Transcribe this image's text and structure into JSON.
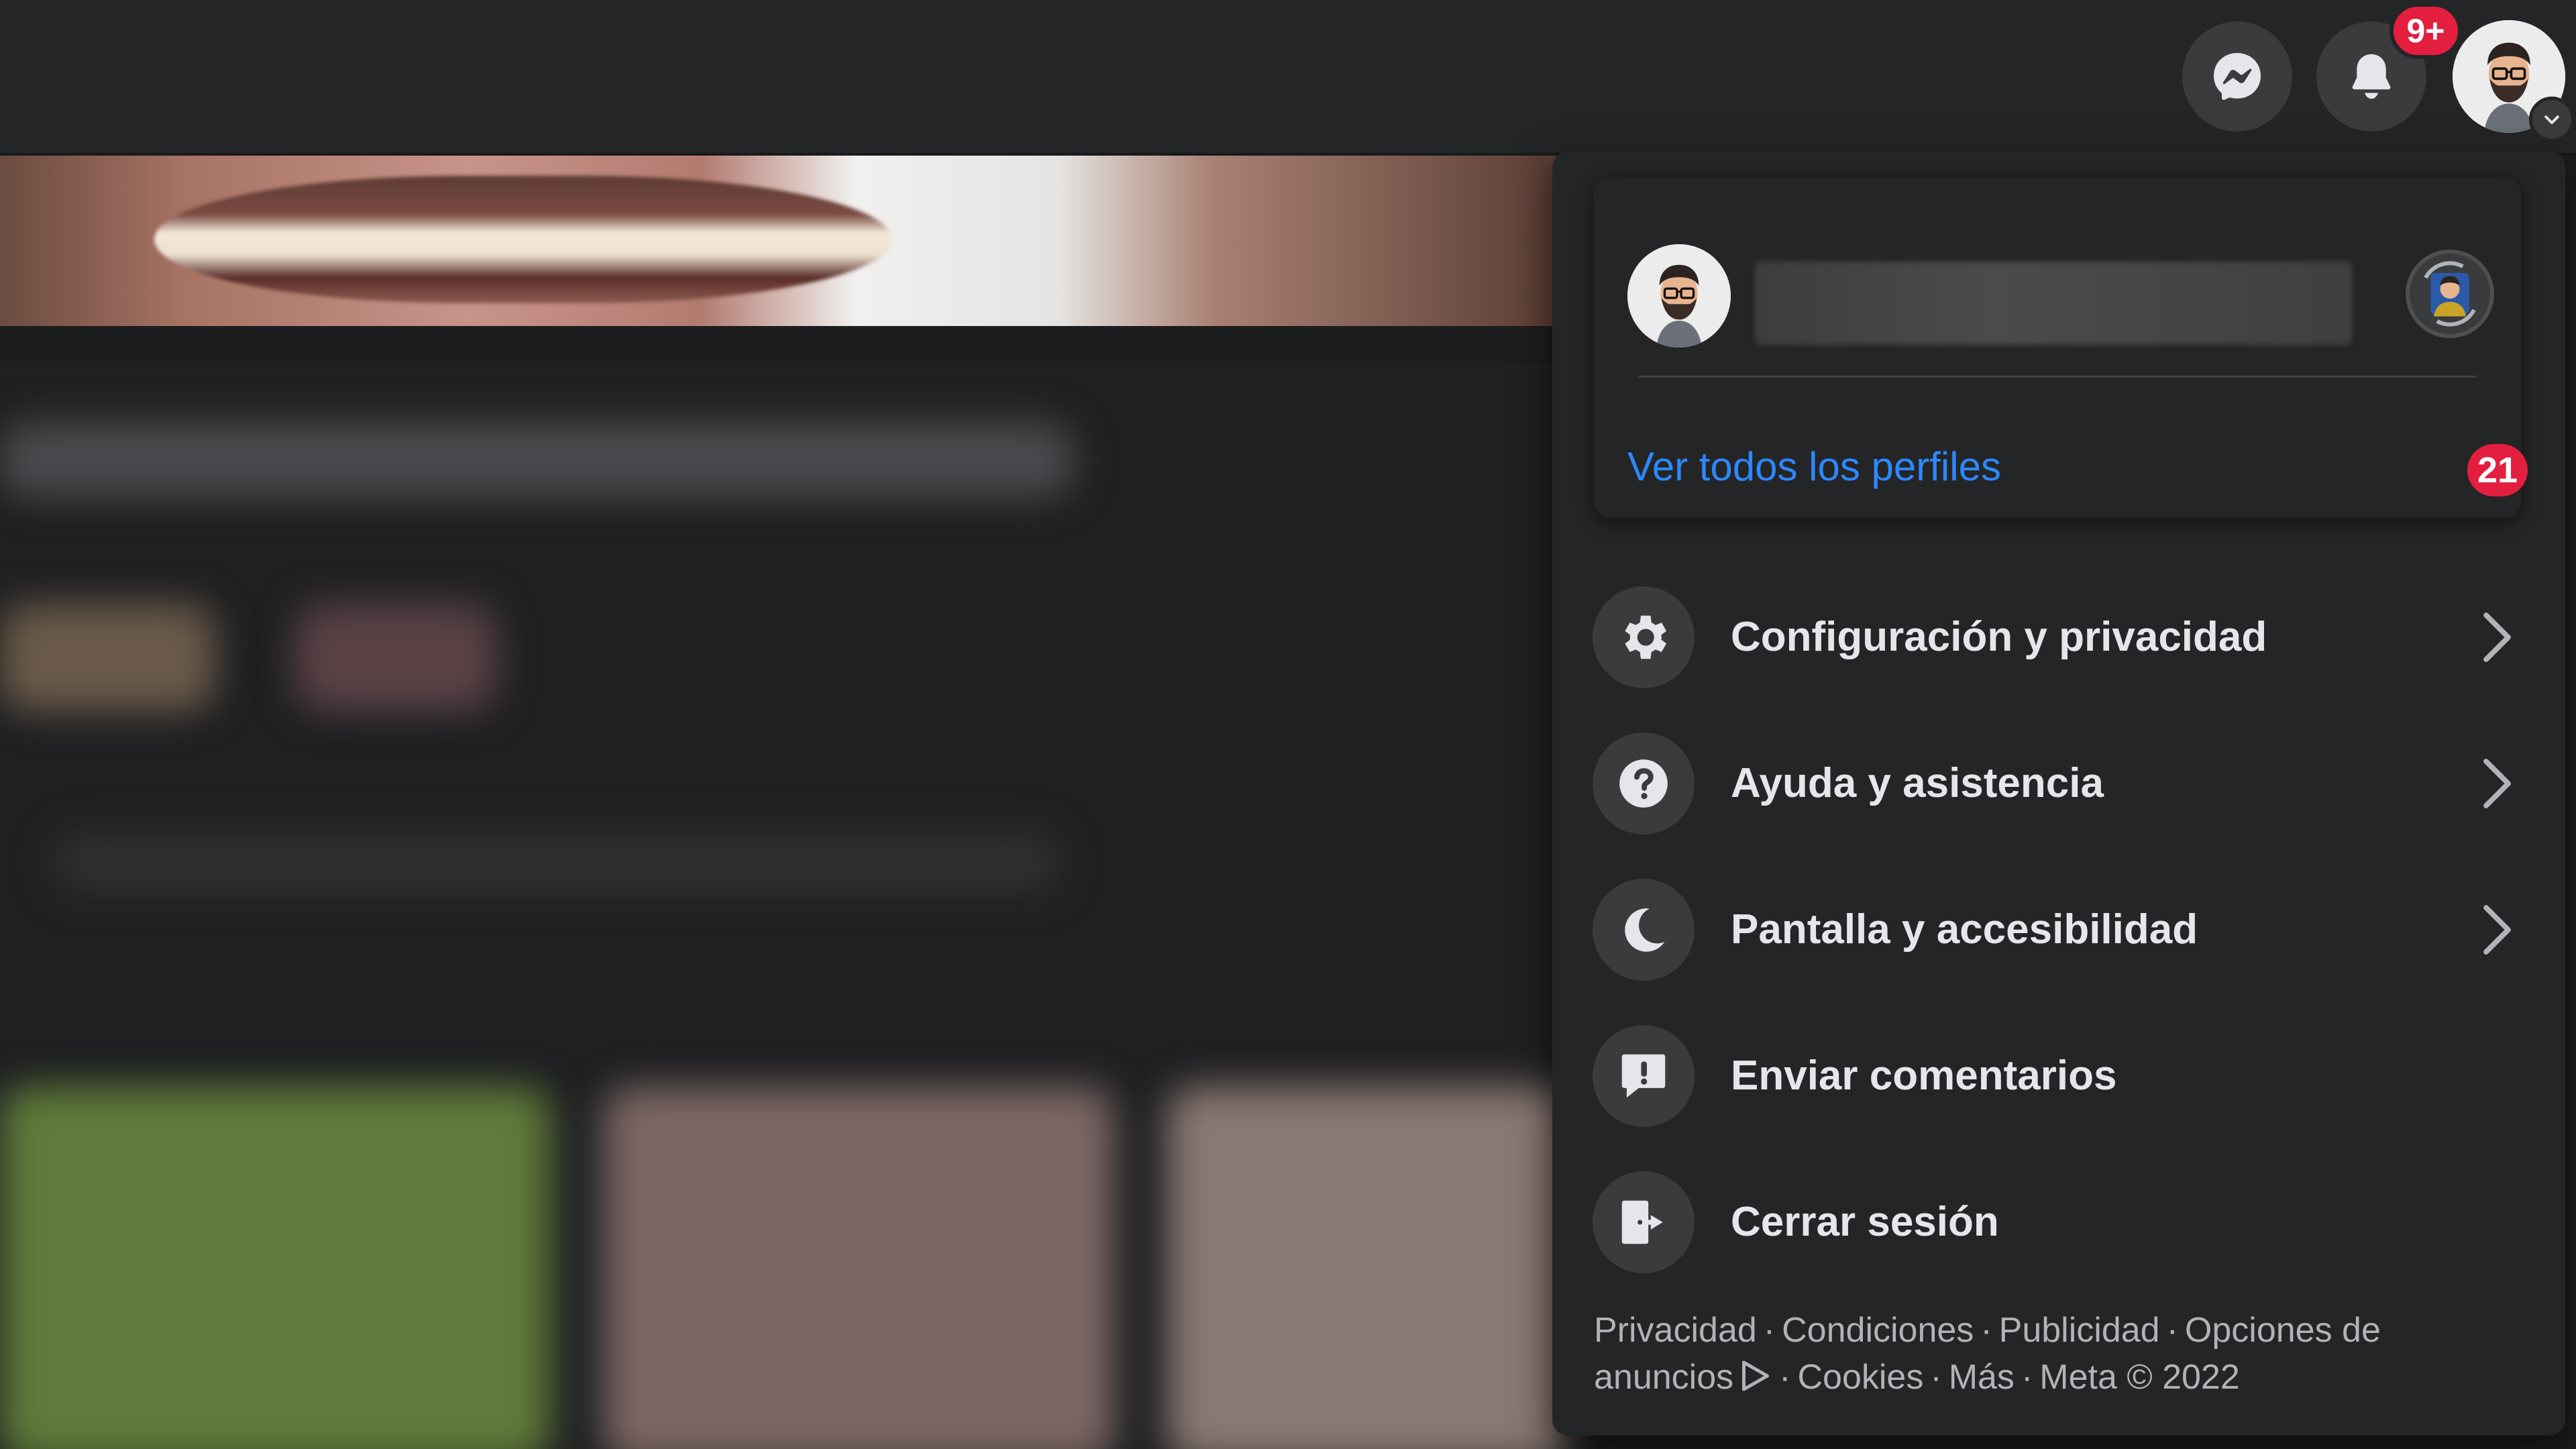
{
  "topbar": {
    "notifications_badge": "9+"
  },
  "account_menu": {
    "see_all_profiles": "Ver todos los perfiles",
    "profiles_count": "21",
    "items": [
      {
        "label": "Configuración y privacidad",
        "icon": "gear-icon",
        "has_submenu": true
      },
      {
        "label": "Ayuda y asistencia",
        "icon": "help-icon",
        "has_submenu": true
      },
      {
        "label": "Pantalla y accesibilidad",
        "icon": "moon-icon",
        "has_submenu": true
      },
      {
        "label": "Enviar comentarios",
        "icon": "feedback-icon",
        "has_submenu": false
      },
      {
        "label": "Cerrar sesión",
        "icon": "logout-icon",
        "has_submenu": false
      }
    ],
    "footer": {
      "privacy": "Privacidad",
      "terms": "Condiciones",
      "advertising": "Publicidad",
      "ad_choices_prefix": "Opciones de",
      "ad_choices_suffix": "anuncios",
      "cookies": "Cookies",
      "more": "Más",
      "copyright": "Meta © 2022",
      "separator": "·"
    }
  },
  "colors": {
    "background": "#1c1d1f",
    "surface": "#242526",
    "button": "#3a3b3c",
    "primary_text": "#e4e6eb",
    "secondary_text": "#b0b3b8",
    "link": "#2d88ff",
    "badge": "#e41e3f"
  }
}
